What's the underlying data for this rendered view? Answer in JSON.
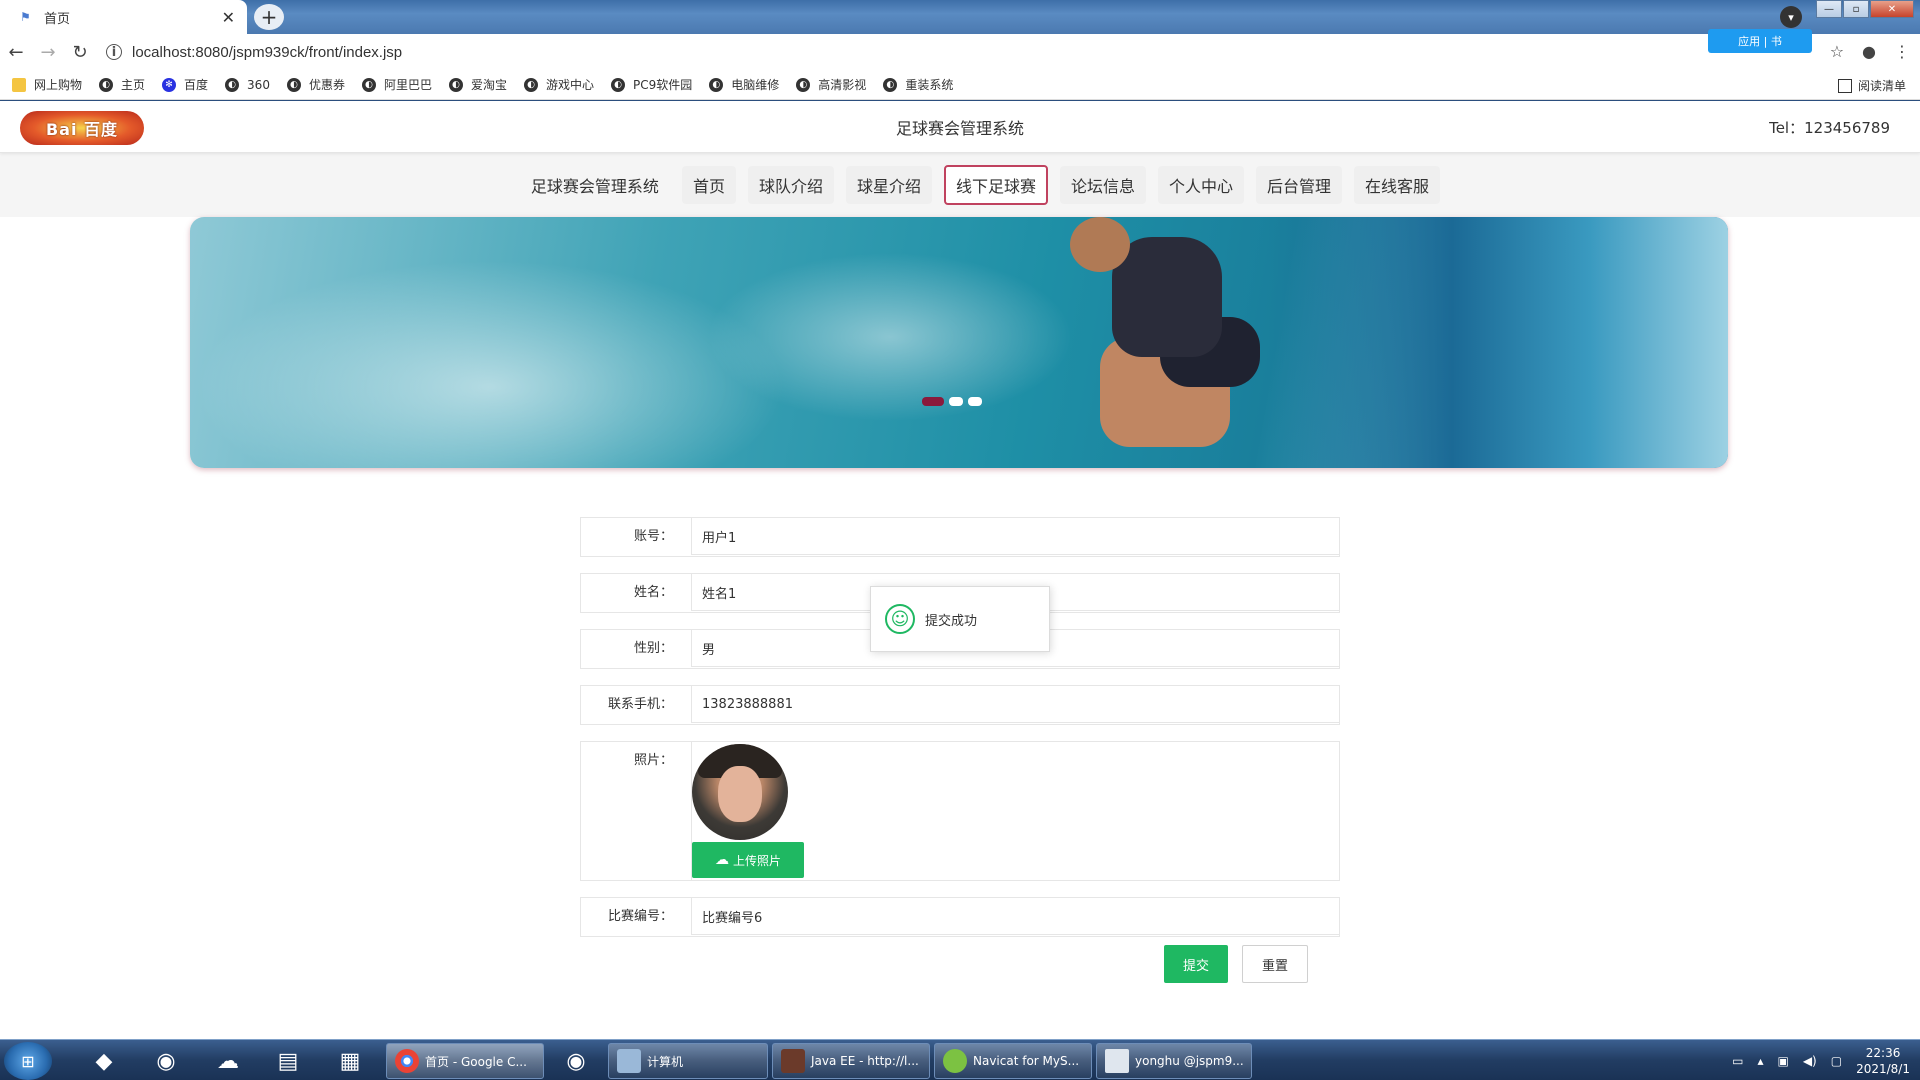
{
  "browser": {
    "tab_title": "首页",
    "url": "localhost:8080/jspm939ck/front/index.jsp",
    "ext_badge": "应用 | 书",
    "bookmarks": [
      "网上购物",
      "主页",
      "百度",
      "360",
      "优惠券",
      "阿里巴巴",
      "爱淘宝",
      "游戏中心",
      "PC9软件园",
      "电脑维修",
      "高清影视",
      "重装系统"
    ],
    "reading_list": "阅读清单"
  },
  "site": {
    "logo_text": "Bai 百度",
    "title": "足球赛会管理系统",
    "tel": "Tel：123456789",
    "nav": [
      "足球赛会管理系统",
      "首页",
      "球队介绍",
      "球星介绍",
      "线下足球赛",
      "论坛信息",
      "个人中心",
      "后台管理",
      "在线客服"
    ],
    "active_nav": "线下足球赛"
  },
  "form": {
    "account_label": "账号：",
    "account_value": "用户1",
    "name_label": "姓名：",
    "name_value": "姓名1",
    "gender_label": "性别：",
    "gender_value": "男",
    "phone_label": "联系手机：",
    "phone_value": "13823888881",
    "photo_label": "照片：",
    "upload_label": "上传照片",
    "match_label": "比赛编号：",
    "match_value": "比赛编号6",
    "submit_label": "提交",
    "reset_label": "重置"
  },
  "toast": {
    "message": "提交成功"
  },
  "taskbar": {
    "tasks": [
      "首页 - Google C...",
      "计算机",
      "Java EE - http://l...",
      "Navicat for MyS...",
      "yonghu @jspm9..."
    ],
    "time": "22:36",
    "date": "2021/8/1"
  },
  "colors": {
    "accent_green": "#1fb862",
    "active_nav_border": "#c0425f"
  }
}
